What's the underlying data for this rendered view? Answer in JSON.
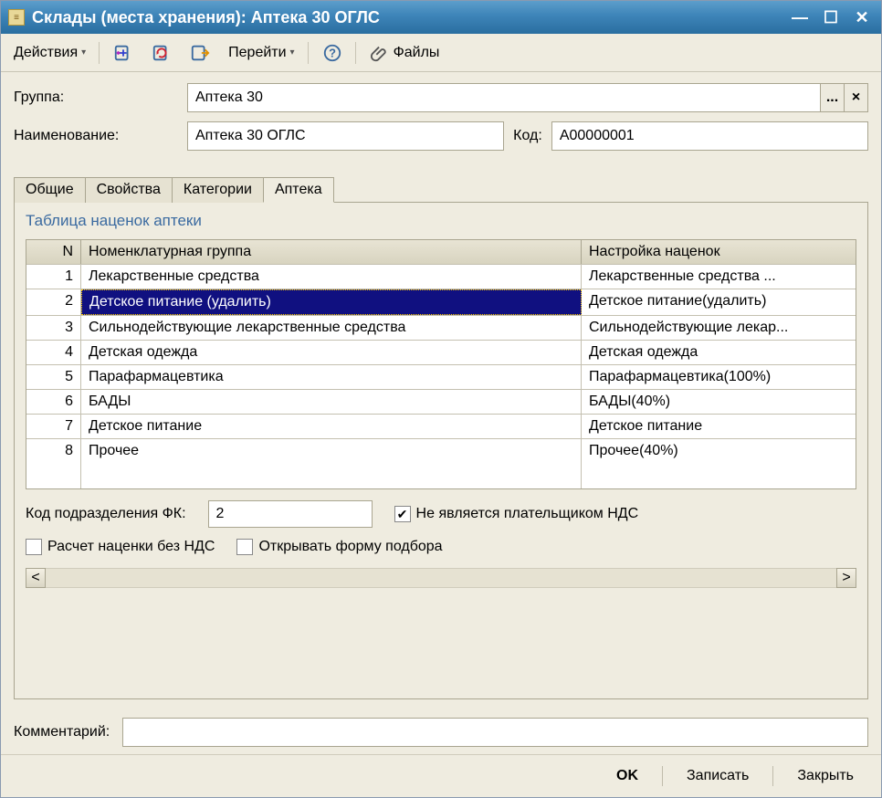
{
  "window": {
    "title": "Склады (места хранения): Аптека 30 ОГЛС"
  },
  "toolbar": {
    "actions": "Действия",
    "goto": "Перейти",
    "files": "Файлы"
  },
  "fields": {
    "group_label": "Группа:",
    "group_value": "Аптека 30",
    "name_label": "Наименование:",
    "name_value": "Аптека 30 ОГЛС",
    "code_label": "Код:",
    "code_value": "A00000001"
  },
  "tabs": [
    "Общие",
    "Свойства",
    "Категории",
    "Аптека"
  ],
  "active_tab": 3,
  "table": {
    "title": "Таблица наценок аптеки",
    "headers": {
      "n": "N",
      "group": "Номенклатурная группа",
      "markup": "Настройка наценок"
    },
    "rows": [
      {
        "n": "1",
        "group": "Лекарственные средства",
        "markup": "Лекарственные средства ..."
      },
      {
        "n": "2",
        "group": "Детское питание (удалить)",
        "markup": "Детское питание(удалить)"
      },
      {
        "n": "3",
        "group": "Сильнодействующие лекарственные средства",
        "markup": "Сильнодействующие лекар..."
      },
      {
        "n": "4",
        "group": "Детская одежда",
        "markup": "Детская одежда"
      },
      {
        "n": "5",
        "group": "Парафармацевтика",
        "markup": "Парафармацевтика(100%)"
      },
      {
        "n": "6",
        "group": "БАДЫ",
        "markup": "БАДЫ(40%)"
      },
      {
        "n": "7",
        "group": "Детское питание",
        "markup": "Детское питание"
      },
      {
        "n": "8",
        "group": "Прочее",
        "markup": "Прочее(40%)"
      }
    ],
    "selected_row": 1
  },
  "options": {
    "fk_code_label": "Код подразделения ФК:",
    "fk_code_value": "2",
    "not_vat_payer": "Не является плательщиком НДС",
    "not_vat_payer_checked": true,
    "markup_without_vat": "Расчет наценки без НДС",
    "markup_without_vat_checked": false,
    "open_selection_form": "Открывать форму подбора",
    "open_selection_form_checked": false
  },
  "comment_label": "Комментарий:",
  "comment_value": "",
  "footer": {
    "ok": "OK",
    "save": "Записать",
    "close": "Закрыть"
  }
}
